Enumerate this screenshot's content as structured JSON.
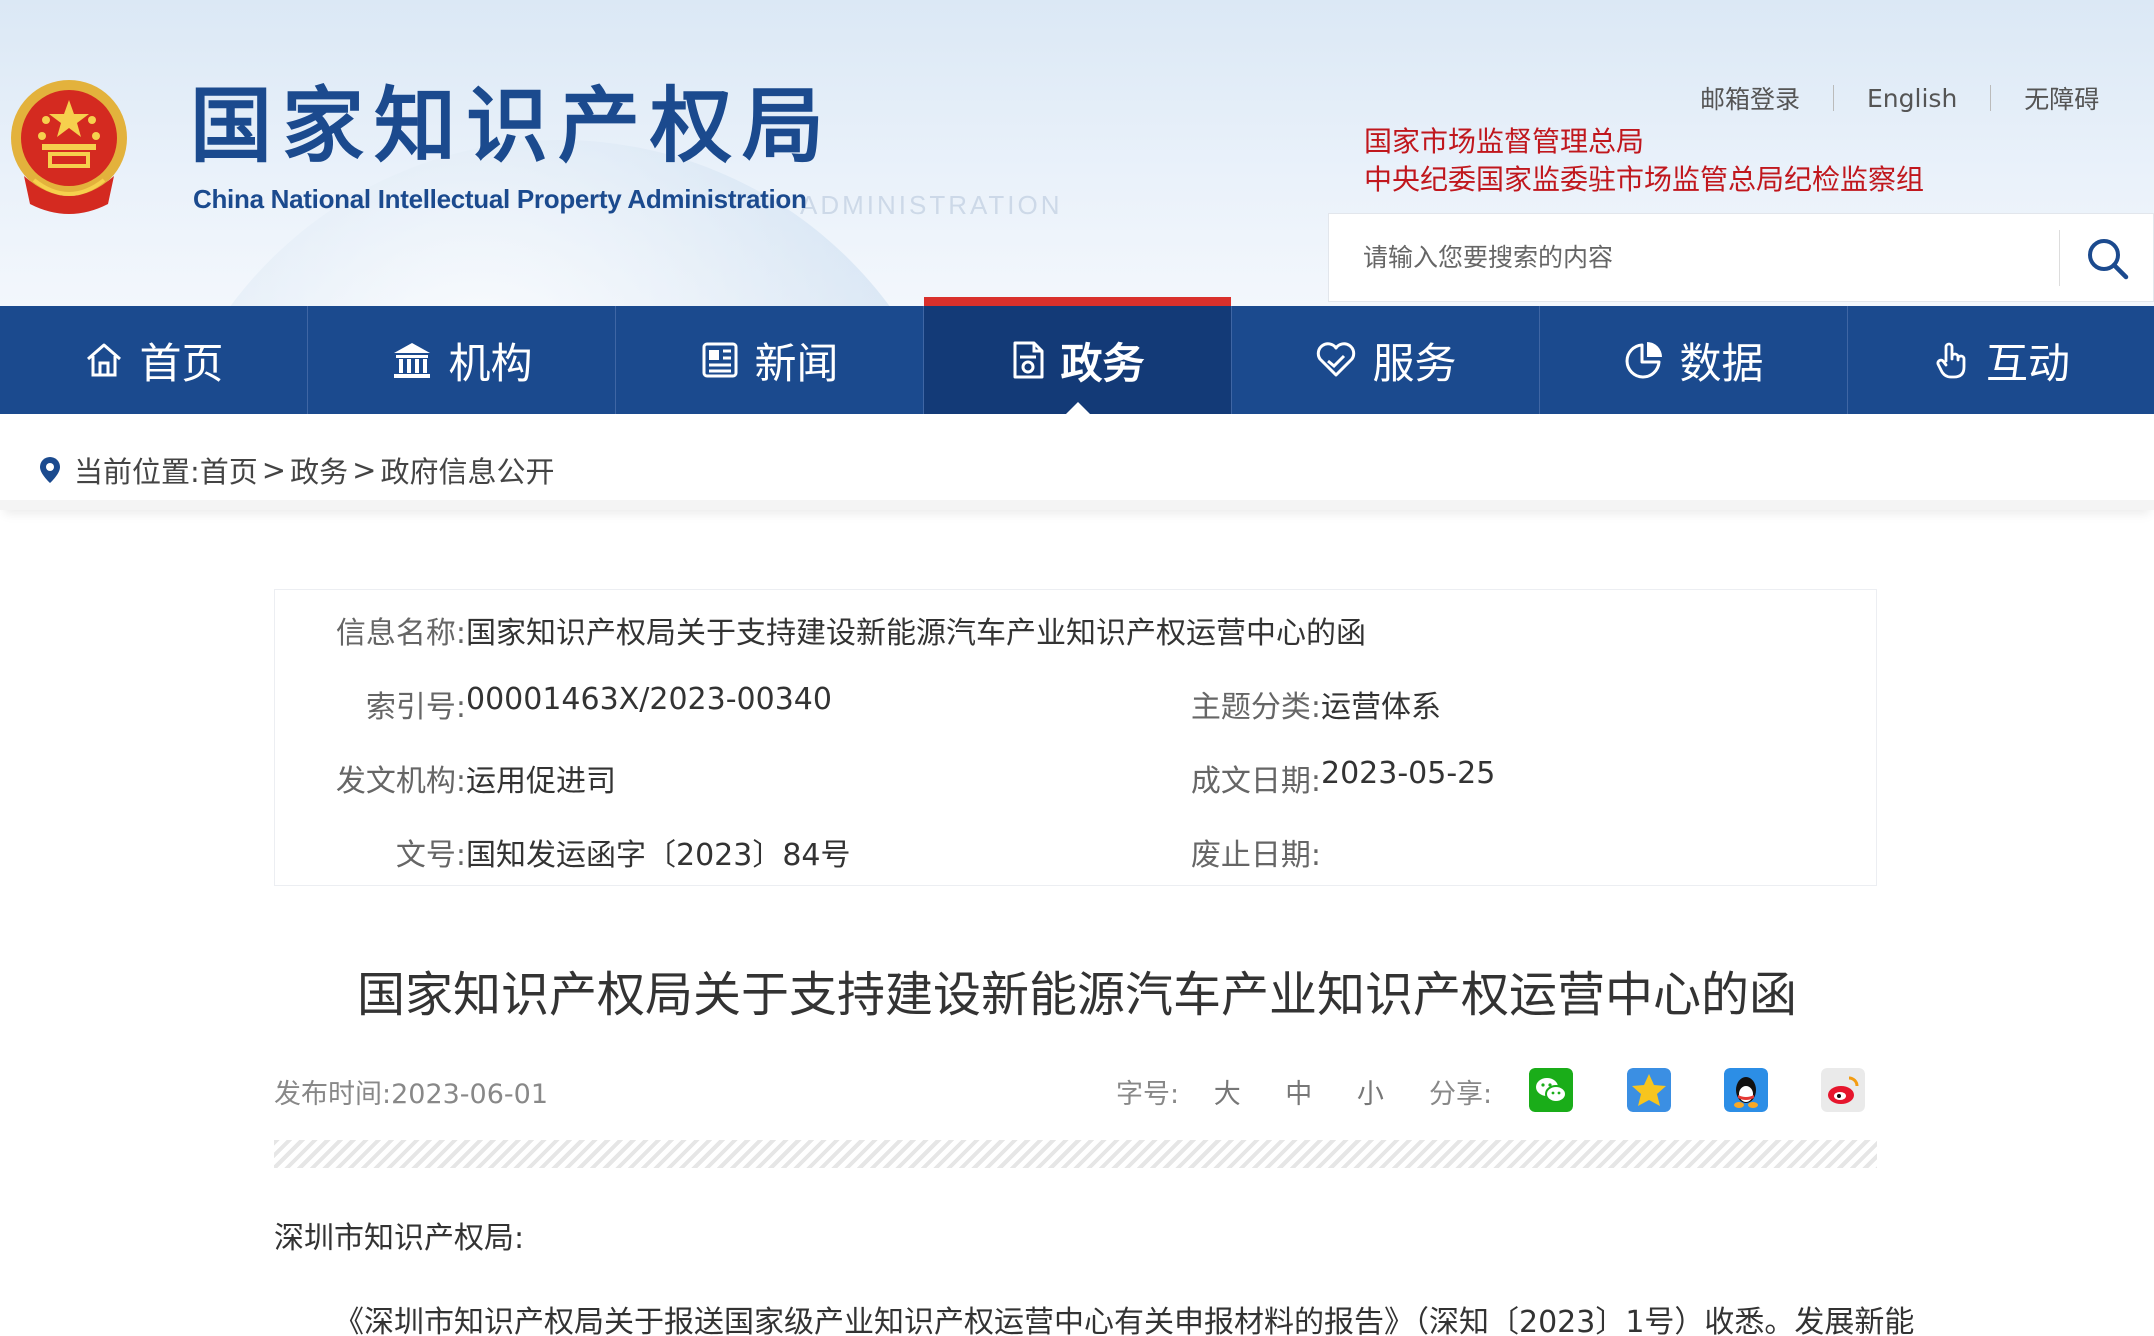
{
  "header": {
    "logo_cn": "国家知识产权局",
    "logo_en": "China National Intellectual Property Administration",
    "top_links": [
      "邮箱登录",
      "English",
      "无障碍"
    ],
    "org_lines": [
      "国家市场监督管理总局",
      "中央纪委国家监委驻市场监管总局纪检监察组"
    ],
    "search_placeholder": "请输入您要搜索的内容",
    "colors": {
      "primary": "#1b4a8e",
      "accent_red": "#c0171d",
      "active_bar": "#d9302c"
    }
  },
  "nav": [
    {
      "label": "首页",
      "icon": "home-icon"
    },
    {
      "label": "机构",
      "icon": "institution-icon"
    },
    {
      "label": "新闻",
      "icon": "news-icon"
    },
    {
      "label": "政务",
      "icon": "document-icon",
      "active": true
    },
    {
      "label": "服务",
      "icon": "service-icon"
    },
    {
      "label": "数据",
      "icon": "pie-chart-icon"
    },
    {
      "label": "互动",
      "icon": "hand-pointer-icon"
    }
  ],
  "breadcrumb": {
    "prefix": "当前位置:",
    "items": [
      "首页",
      "政务",
      "政府信息公开"
    ],
    "separator": ">"
  },
  "info": {
    "name_label": "信息名称:",
    "name_value": "国家知识产权局关于支持建设新能源汽车产业知识产权运营中心的函",
    "index_label": "索引号:",
    "index_value": "00001463X/2023-00340",
    "topic_label": "主题分类:",
    "topic_value": "运营体系",
    "issuer_label": "发文机构:",
    "issuer_value": "运用促进司",
    "date_label": "成文日期:",
    "date_value": "2023-05-25",
    "docno_label": "文号:",
    "docno_value": "国知发运函字〔2023〕84号",
    "expiry_label": "废止日期:",
    "expiry_value": ""
  },
  "article": {
    "title": "国家知识产权局关于支持建设新能源汽车产业知识产权运营中心的函",
    "publish_time": "发布时间:2023-06-01",
    "font_size_label": "字号:",
    "font_sizes": [
      "大",
      "中",
      "小"
    ],
    "share_label": "分享:",
    "share_icons": [
      "wechat-icon",
      "qzone-icon",
      "qq-icon",
      "weibo-icon"
    ],
    "salutation": "深圳市知识产权局:",
    "paragraph1": "《深圳市知识产权局关于报送国家级产业知识产权运营中心有关申报材料的报告》（深知〔2023〕1号）收悉。发展新能"
  }
}
